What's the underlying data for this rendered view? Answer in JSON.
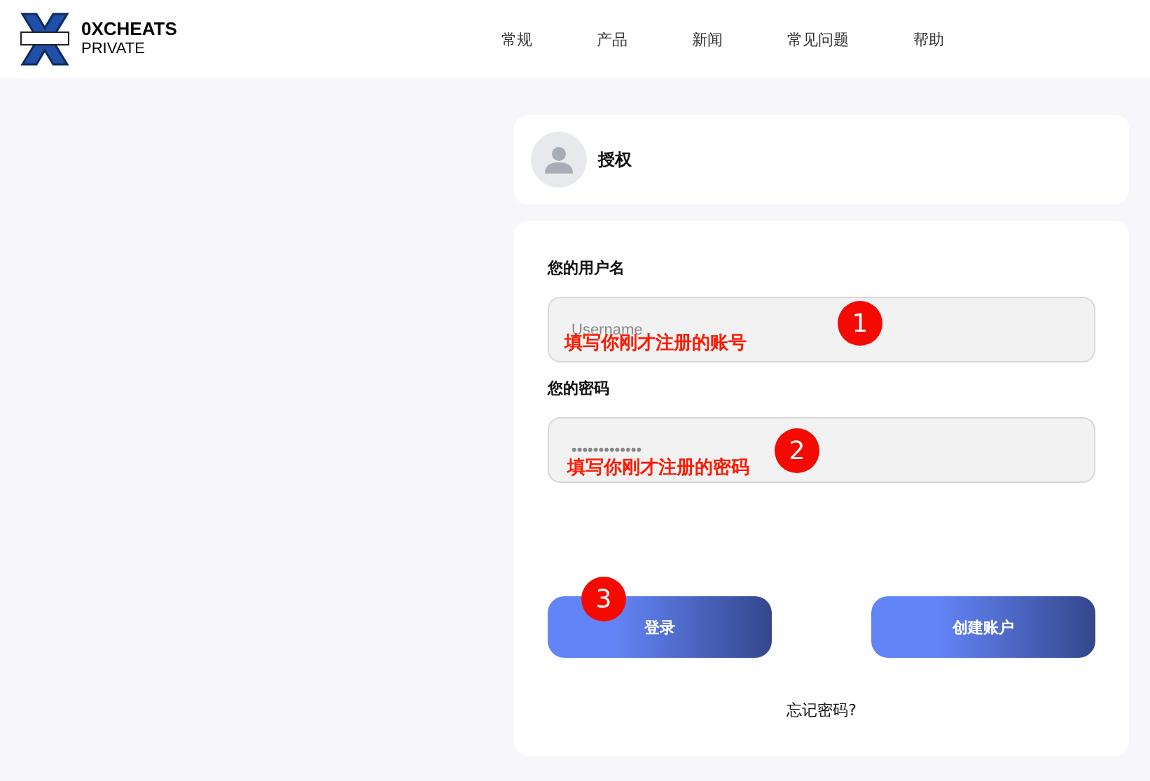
{
  "brand": {
    "name": "0XCHEATS",
    "subtitle": "PRIVATE"
  },
  "nav": [
    "常规",
    "产品",
    "新闻",
    "常见问题",
    "帮助"
  ],
  "auth": {
    "title": "授权"
  },
  "form": {
    "fields": [
      {
        "label": "您的用户名",
        "placeholder": "Username",
        "note": "填写你刚才注册的账号",
        "badge": "1"
      },
      {
        "label": "您的密码",
        "placeholder": "•••••••••••••",
        "note": "填写你刚才注册的密码",
        "badge": "2"
      }
    ],
    "buttons": [
      {
        "label": "登录",
        "badge": "3"
      },
      {
        "label": "创建账户"
      }
    ],
    "forgot": "忘记密码?"
  }
}
